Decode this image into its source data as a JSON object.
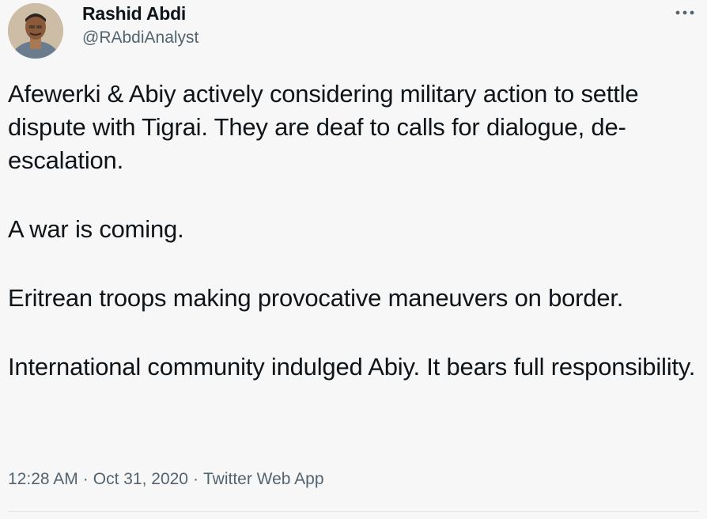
{
  "author": {
    "name": "Rashid Abdi",
    "handle": "@RAbdiAnalyst"
  },
  "tweet": {
    "paragraphs": [
      "Afewerki & Abiy actively considering military action to settle dispute with Tigrai. They are deaf to calls for dialogue, de-escalation.",
      "A war is coming.",
      "Eritrean troops making provocative maneuvers on border.",
      "International community indulged Abiy. It bears full responsibility."
    ],
    "time": "12:28 AM",
    "date": "Oct 31, 2020",
    "source": "Twitter Web App",
    "separator": "·"
  },
  "icons": {
    "more": "more-horizontal-icon",
    "avatar": "profile-photo"
  },
  "colors": {
    "text": "#0f1419",
    "secondary": "#536471",
    "background": "#f7f7f7"
  }
}
